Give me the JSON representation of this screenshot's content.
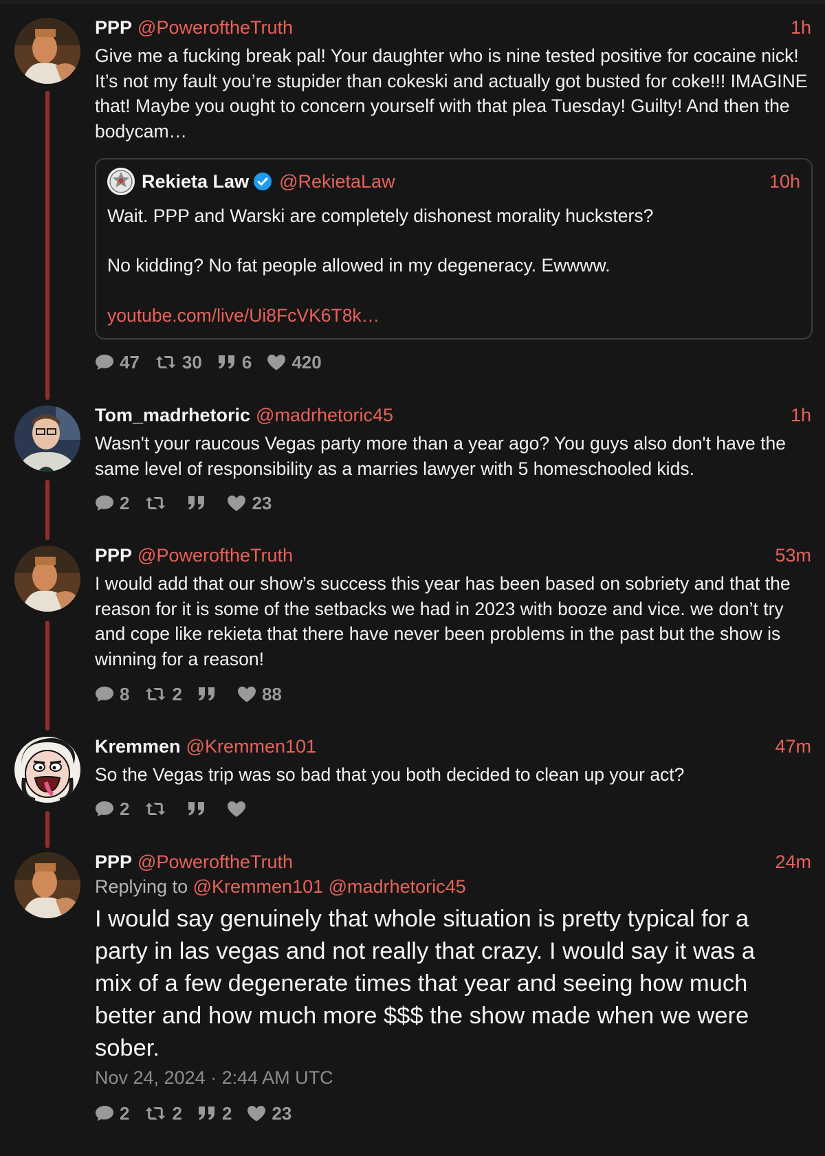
{
  "colors": {
    "background": "#161616",
    "accent": "#e8615a",
    "thread_line": "#8d2f2a",
    "muted": "#9a9a9a"
  },
  "tweets": [
    {
      "name": "PPP",
      "handle": "@PoweroftheTruth",
      "time": "1h",
      "text": "Give me a fucking break pal! Your daughter who is nine tested positive for cocaine nick! It’s not my fault you’re stupider than cokeski and actually got busted for coke!!! IMAGINE that! Maybe you ought to concern yourself with that plea Tuesday! Guilty! And then the bodycam…",
      "quote": {
        "name": "Rekieta Law",
        "handle": "@RekietaLaw",
        "time": "10h",
        "line1": "Wait.  PPP and Warski are completely dishonest morality hucksters?",
        "line2": "No kidding?  No fat people allowed in my degeneracy.  Ewwww.",
        "link": "youtube.com/live/Ui8FcVK6T8k…"
      },
      "stats": {
        "replies": "47",
        "retweets": "30",
        "quotes": "6",
        "likes": "420"
      }
    },
    {
      "name": "Tom_madrhetoric",
      "handle": "@madrhetoric45",
      "time": "1h",
      "text": "Wasn't your raucous Vegas party more than a year ago? You guys also don't have the same level of responsibility as a marries lawyer with 5 homeschooled kids.",
      "stats": {
        "replies": "2",
        "retweets": "",
        "quotes": "",
        "likes": "23"
      }
    },
    {
      "name": "PPP",
      "handle": "@PoweroftheTruth",
      "time": "53m",
      "text": "I would add that our show’s success this year has been based on sobriety and that the reason for it is some of the setbacks we had in 2023 with booze and vice. we don’t try and cope like rekieta that there have never been problems in the past but the show is winning for a reason!",
      "stats": {
        "replies": "8",
        "retweets": "2",
        "quotes": "",
        "likes": "88"
      }
    },
    {
      "name": "Kremmen",
      "handle": "@Kremmen101",
      "time": "47m",
      "text": "So the Vegas trip was so bad that you both decided to clean up your act?",
      "stats": {
        "replies": "2",
        "retweets": "",
        "quotes": "",
        "likes": ""
      }
    },
    {
      "name": "PPP",
      "handle": "@PoweroftheTruth",
      "time": "24m",
      "replying_prefix": "Replying to",
      "replying_to_1": "@Kremmen101",
      "replying_to_2": "@madrhetoric45",
      "text": "I would say genuinely that whole situation is pretty typical for a party in las vegas and not really that crazy. I would say it was a mix of a few degenerate times that year and seeing how much better and how much more $$$ the show made when we were sober.",
      "date": "Nov 24, 2024 · 2:44 AM UTC",
      "stats": {
        "replies": "2",
        "retweets": "2",
        "quotes": "2",
        "likes": "23"
      }
    }
  ]
}
